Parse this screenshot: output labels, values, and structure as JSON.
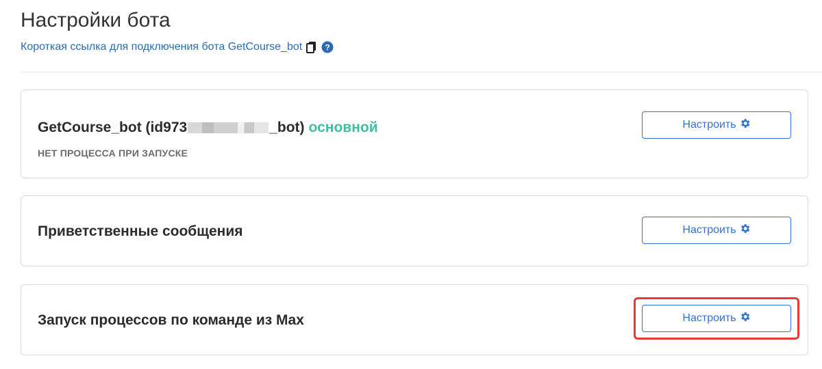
{
  "page": {
    "title": "Настройки бота",
    "short_link_text": "Короткая ссылка для подключения бота GetCourse_bot"
  },
  "icons": {
    "copy": "copy-icon",
    "help": "help-icon",
    "settings": "gear-icon"
  },
  "colors": {
    "link": "#2b6cb0",
    "accent": "#2f72d6",
    "main_badge": "#3fbf9f",
    "highlight": "#e53935"
  },
  "cards": [
    {
      "title_prefix": "GetCourse_bot (id973",
      "title_suffix": "_bot)",
      "badge": "основной",
      "note": "НЕТ ПРОЦЕССА ПРИ ЗАПУСКЕ",
      "button_label": "Настроить"
    },
    {
      "title": "Приветственные сообщения",
      "button_label": "Настроить"
    },
    {
      "title": "Запуск процессов по команде из Max",
      "button_label": "Настроить"
    }
  ]
}
